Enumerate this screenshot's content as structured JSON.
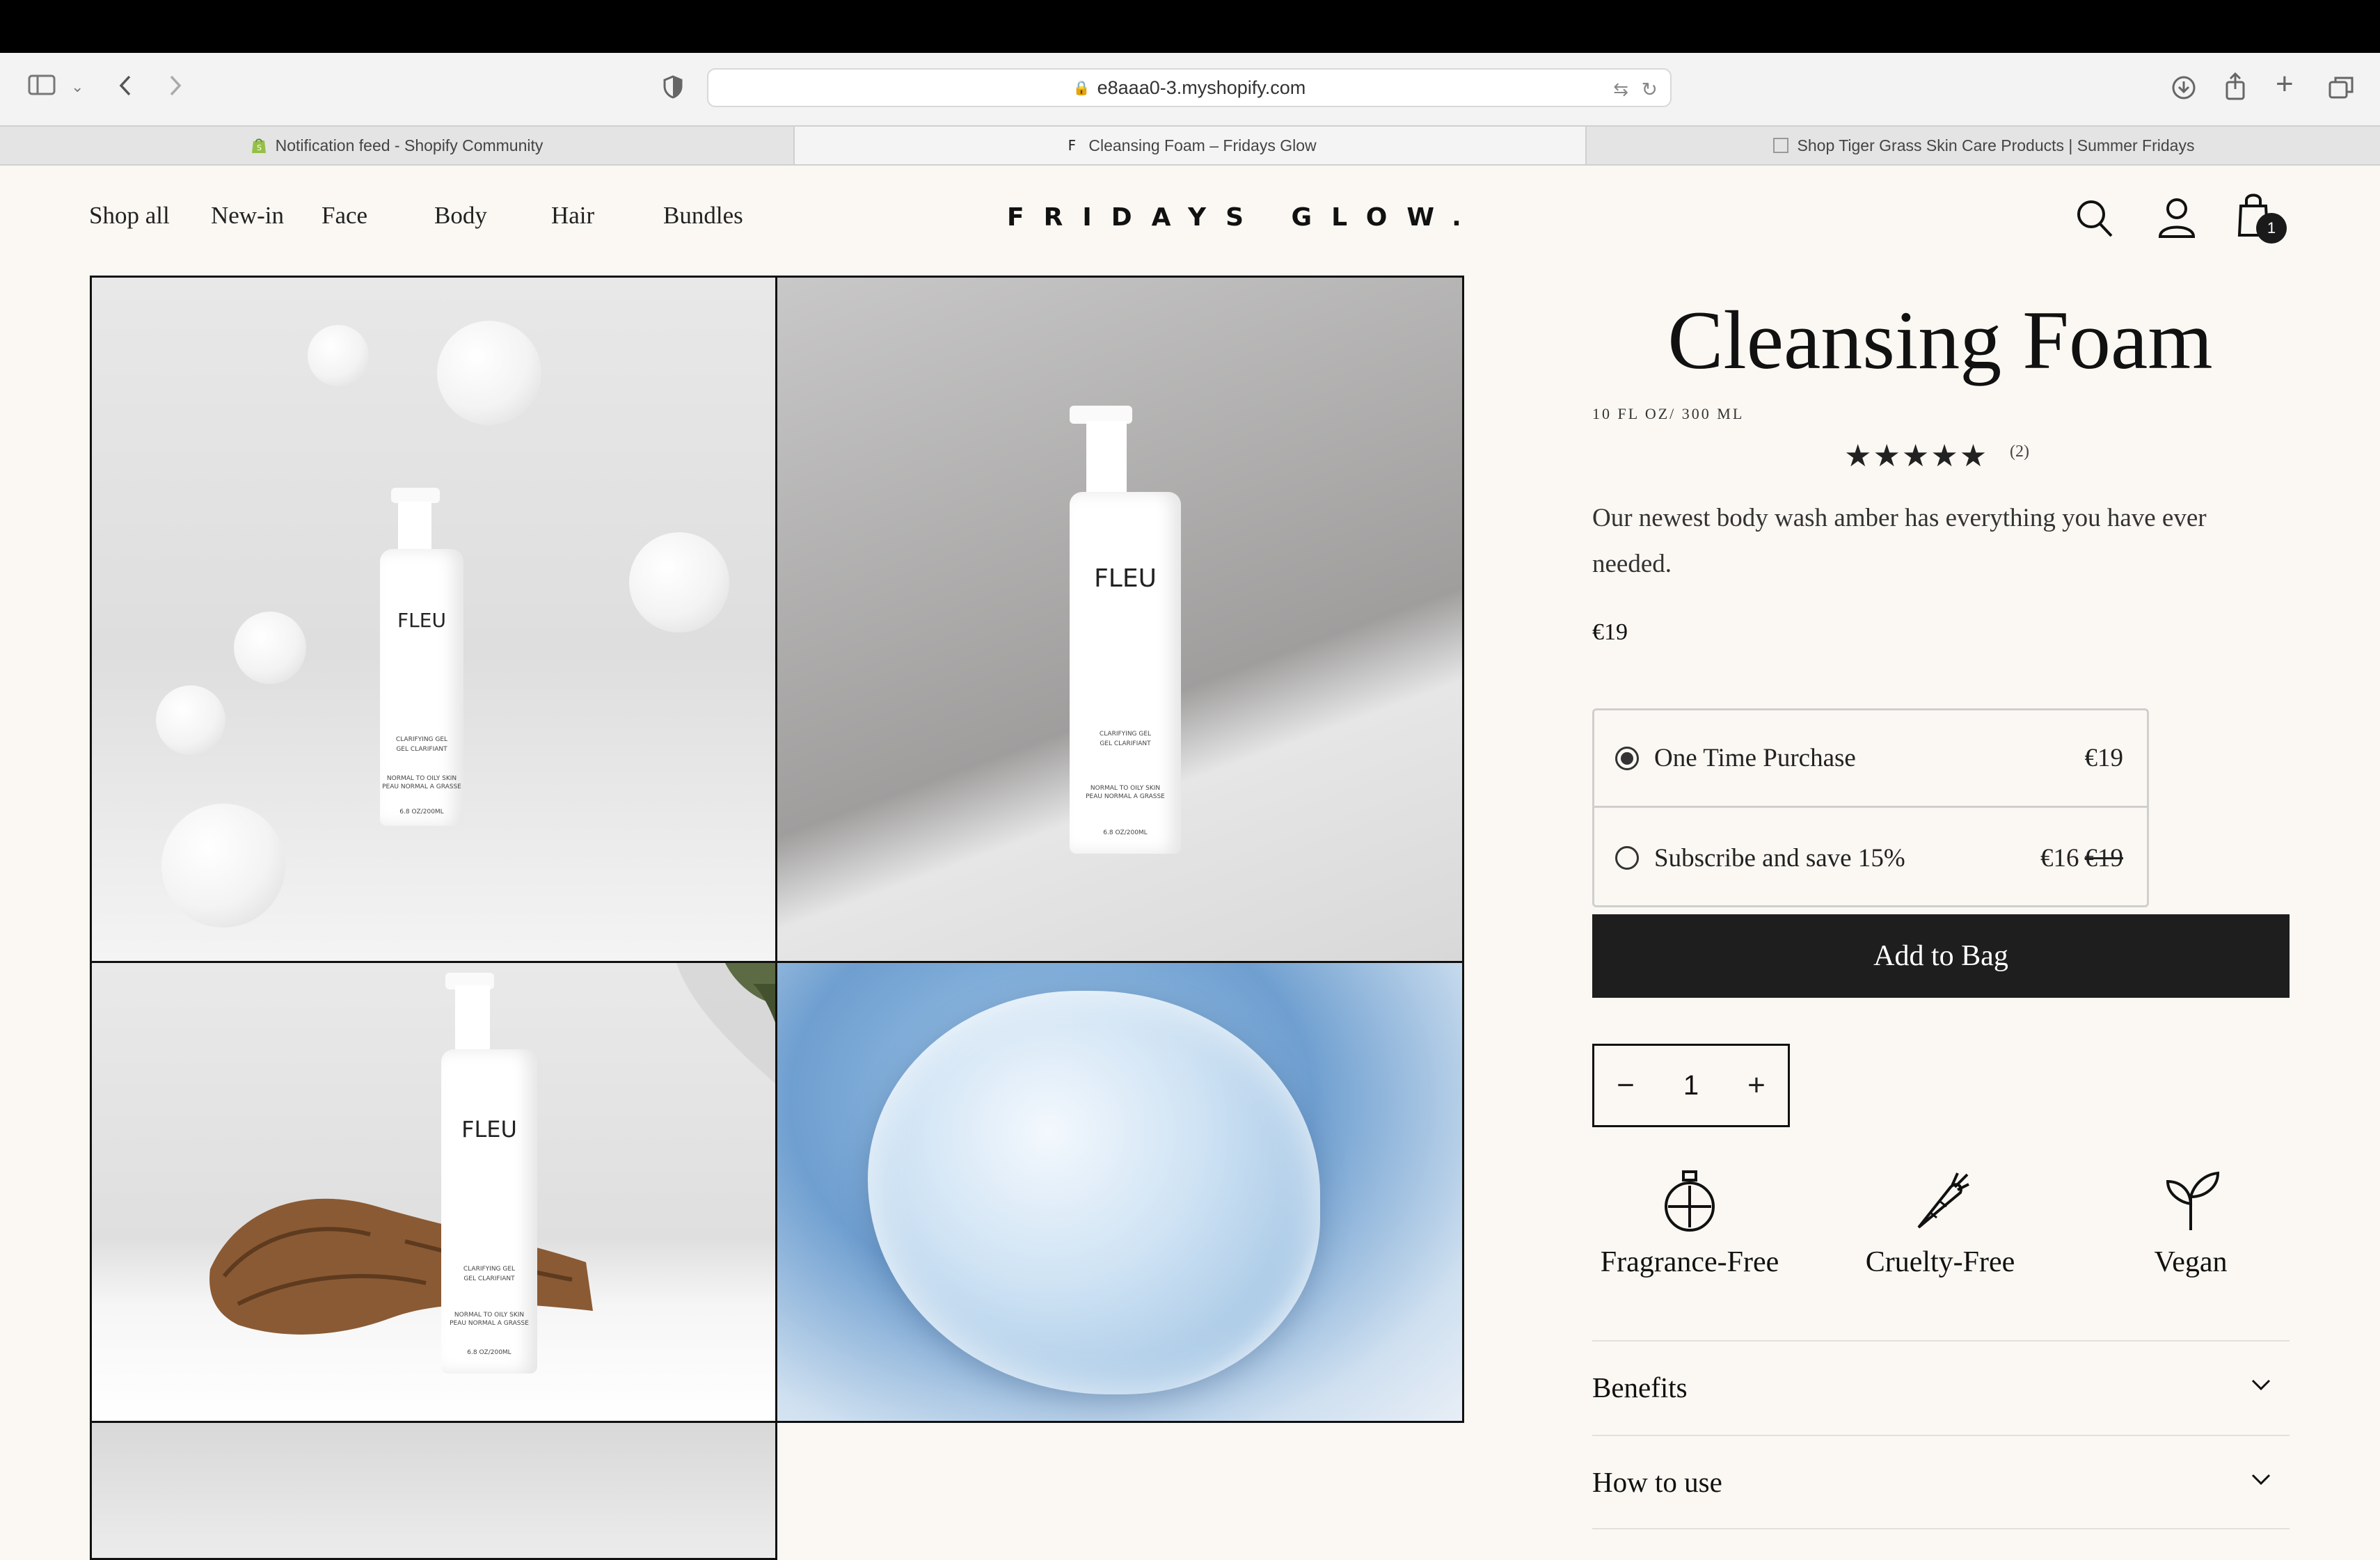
{
  "browser": {
    "url": "e8aaa0-3.myshopify.com",
    "tabs": [
      {
        "label": "Notification feed - Shopify Community",
        "icon": "shopify-icon"
      },
      {
        "label": "Cleansing Foam – Fridays Glow",
        "icon": "F"
      },
      {
        "label": "Shop Tiger Grass Skin Care Products | Summer Fridays",
        "icon": "page-icon"
      }
    ]
  },
  "header": {
    "nav": [
      "Shop all",
      "New-in",
      "Face",
      "Body",
      "Hair",
      "Bundles"
    ],
    "logo": "FRIDAYS GLOW.",
    "cart_count": "1"
  },
  "gallery": {
    "bottle_brand": "FLEU",
    "bottle_line1": "CLARIFYING GEL",
    "bottle_line2": "GEL CLARIFIANT",
    "bottle_line3": "NORMAL TO OILY SKIN",
    "bottle_line4": "PEAU NORMAL A GRASSE",
    "bottle_line5": "6.8 OZ/200ML"
  },
  "product": {
    "title": "Cleansing Foam",
    "size": "10 FL OZ/ 300 ML",
    "rating": 5,
    "stars": "★★★★★",
    "reviews": "(2)",
    "description": "Our newest body wash amber has everything you have ever needed.",
    "price": "€19",
    "options": [
      {
        "label": "One Time Purchase",
        "price": "€19",
        "old_price": "",
        "selected": true
      },
      {
        "label": "Subscribe and save 15%",
        "price": "€16",
        "old_price": "€19",
        "selected": false
      }
    ],
    "add_to_bag": "Add to Bag",
    "quantity": "1",
    "minus": "−",
    "plus": "+",
    "features": [
      {
        "label": "Fragrance-Free",
        "icon": "fragrance-free-icon"
      },
      {
        "label": "Cruelty-Free",
        "icon": "carrot-icon"
      },
      {
        "label": "Vegan",
        "icon": "sprout-icon"
      }
    ],
    "accordions": [
      "Benefits",
      "How to use"
    ]
  }
}
